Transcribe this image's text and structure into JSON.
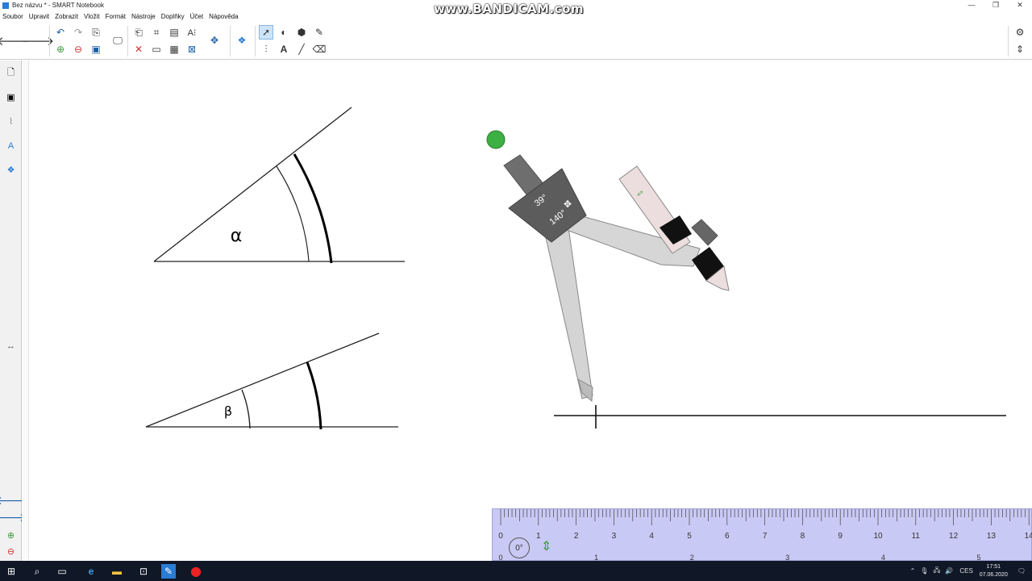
{
  "window": {
    "title": "Bez názvu * - SMART Notebook",
    "controls": [
      "—",
      "❐",
      "✕"
    ]
  },
  "watermark": "www.BANDICAM.com",
  "menu": [
    "Soubor",
    "Upravit",
    "Zobrazit",
    "Vložit",
    "Formát",
    "Nástroje",
    "Doplňky",
    "Účet",
    "Nápověda"
  ],
  "canvas": {
    "angle_alpha_label": "α",
    "angle_beta_label": "β",
    "compass": {
      "angle_label": "39°",
      "secondary_label": "140°"
    },
    "ruler": {
      "angle_label": "0°",
      "cm_ticks": [
        "0",
        "1",
        "2",
        "3",
        "4",
        "5",
        "6",
        "7",
        "8",
        "9",
        "10",
        "11",
        "12",
        "13",
        "14"
      ],
      "inch_ticks": [
        "0",
        "1",
        "2",
        "3",
        "4",
        "5"
      ]
    }
  },
  "taskbar": {
    "language": "CES",
    "time": "17:51",
    "date": "07.06.2020"
  },
  "colors": {
    "ruler_bg": "#c9c9f5",
    "compass_dot": "#3cb043",
    "taskbar": "#101828"
  }
}
